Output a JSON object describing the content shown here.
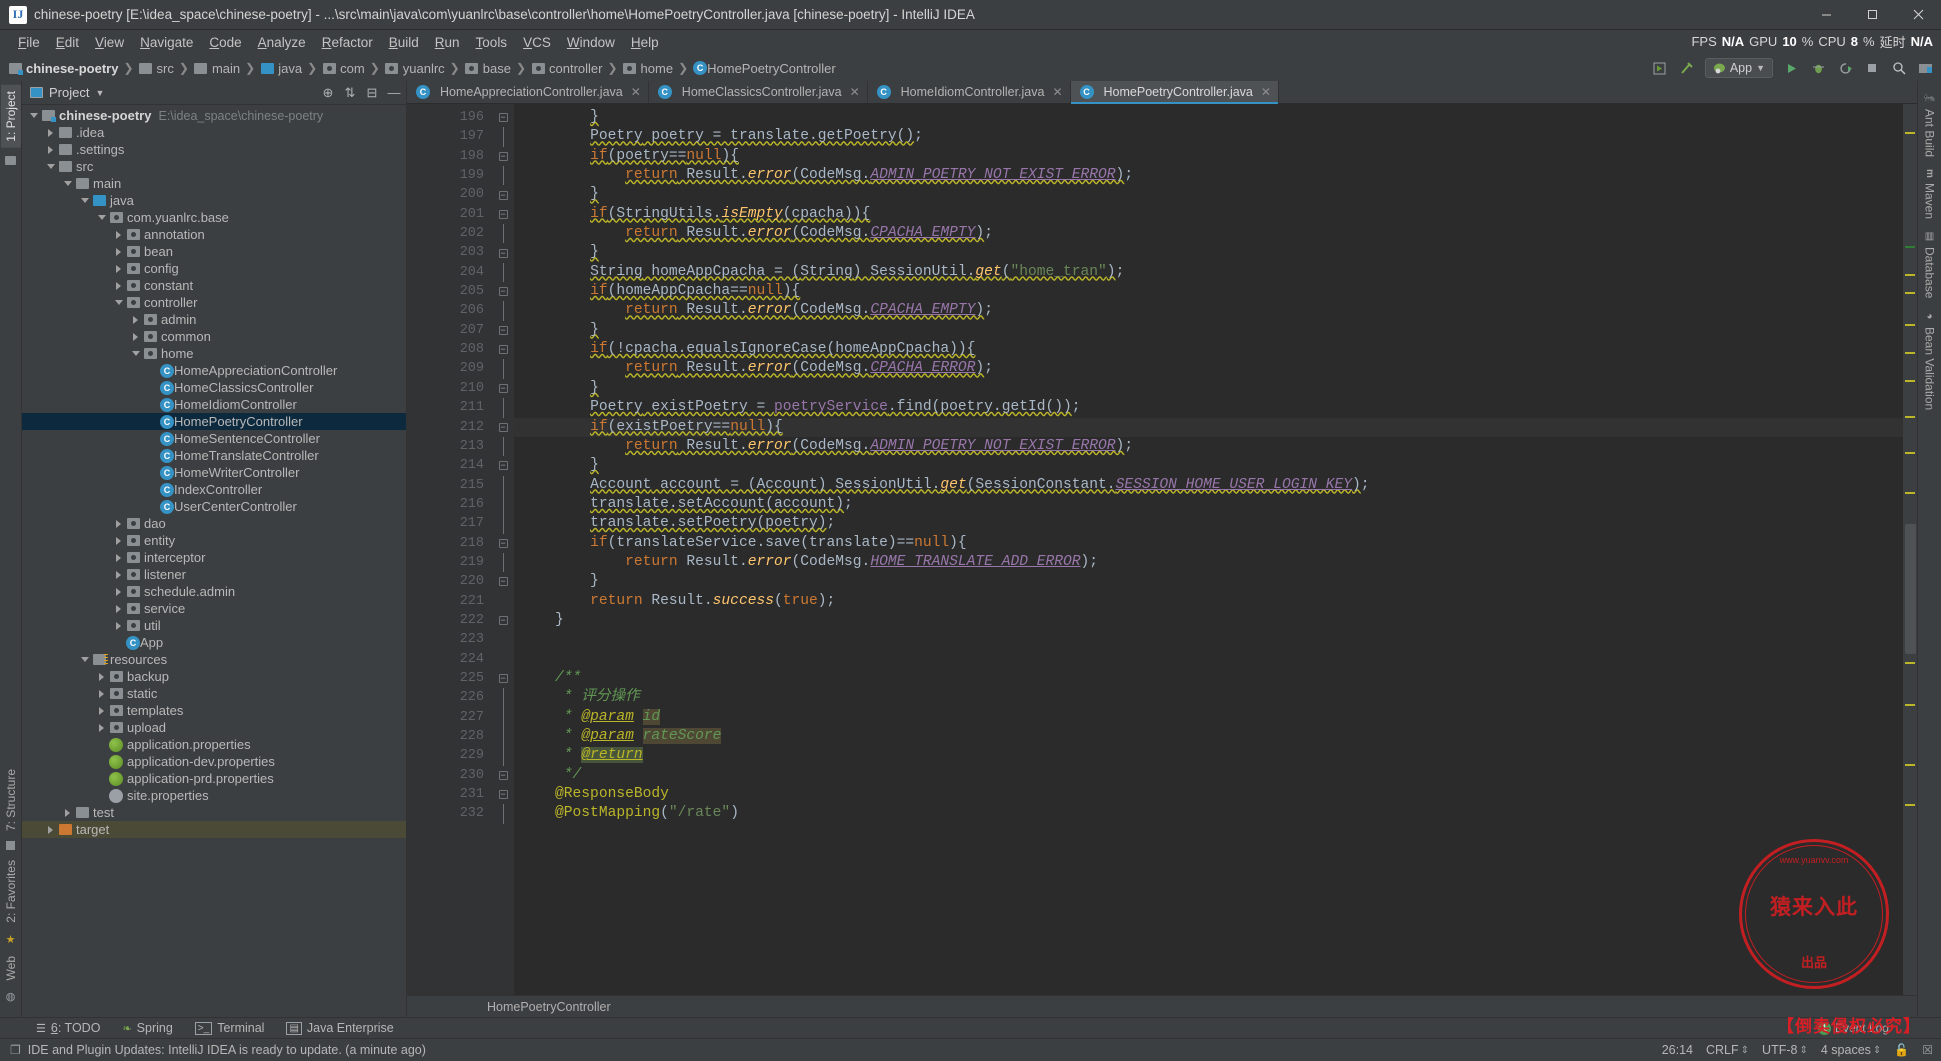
{
  "window": {
    "title": "chinese-poetry [E:\\idea_space\\chinese-poetry] - ...\\src\\main\\java\\com\\yuanlrc\\base\\controller\\home\\HomePoetryController.java [chinese-poetry] - IntelliJ IDEA",
    "app_icon": "IJ",
    "minimize_label": "Minimize",
    "maximize_label": "Maximize",
    "close_label": "Close"
  },
  "menu": {
    "items": [
      "File",
      "Edit",
      "View",
      "Navigate",
      "Code",
      "Analyze",
      "Refactor",
      "Build",
      "Run",
      "Tools",
      "VCS",
      "Window",
      "Help"
    ],
    "perf": {
      "fps_label": "FPS",
      "fps_value": "N/A",
      "gpu_label": "GPU",
      "gpu_value": "10",
      "gpu_unit": "%",
      "cpu_label": "CPU",
      "cpu_value": "8",
      "cpu_unit": "%",
      "latency_label": "延时",
      "latency_value": "N/A"
    }
  },
  "navbar": {
    "crumbs": [
      {
        "label": "chinese-poetry",
        "icon": "module-folder-icon",
        "bold": true
      },
      {
        "label": "src",
        "icon": "folder-icon",
        "bold": false
      },
      {
        "label": "main",
        "icon": "folder-icon",
        "bold": false
      },
      {
        "label": "java",
        "icon": "source-folder-icon",
        "bold": false
      },
      {
        "label": "com",
        "icon": "package-icon",
        "bold": false
      },
      {
        "label": "yuanlrc",
        "icon": "package-icon",
        "bold": false
      },
      {
        "label": "base",
        "icon": "package-icon",
        "bold": false
      },
      {
        "label": "controller",
        "icon": "package-icon",
        "bold": false
      },
      {
        "label": "home",
        "icon": "package-icon",
        "bold": false
      },
      {
        "label": "HomePoetryController",
        "icon": "class-icon",
        "bold": false
      }
    ],
    "run_config": "App",
    "right_icons": [
      "build-icon",
      "hammer-icon",
      "run-config-selector",
      "run-icon",
      "debug-icon",
      "coverage-icon",
      "stop-icon",
      "search-icon",
      "project-structure-icon"
    ]
  },
  "project_panel": {
    "header_label": "Project",
    "header_icons": [
      "locate-icon",
      "sort-icon",
      "collapse-all-icon",
      "hide-icon"
    ],
    "tree": [
      {
        "depth": 0,
        "label": "chinese-poetry",
        "path": "E:\\idea_space\\chinese-poetry",
        "icon": "module-folder-icon",
        "arrow": "open",
        "bold": true
      },
      {
        "depth": 1,
        "label": ".idea",
        "icon": "folder-icon",
        "arrow": "closed"
      },
      {
        "depth": 1,
        "label": ".settings",
        "icon": "folder-icon",
        "arrow": "closed"
      },
      {
        "depth": 1,
        "label": "src",
        "icon": "folder-icon",
        "arrow": "open"
      },
      {
        "depth": 2,
        "label": "main",
        "icon": "folder-icon",
        "arrow": "open"
      },
      {
        "depth": 3,
        "label": "java",
        "icon": "source-folder-icon",
        "arrow": "open"
      },
      {
        "depth": 4,
        "label": "com.yuanlrc.base",
        "icon": "package-icon",
        "arrow": "open"
      },
      {
        "depth": 5,
        "label": "annotation",
        "icon": "package-icon",
        "arrow": "closed"
      },
      {
        "depth": 5,
        "label": "bean",
        "icon": "package-icon",
        "arrow": "closed"
      },
      {
        "depth": 5,
        "label": "config",
        "icon": "package-icon",
        "arrow": "closed"
      },
      {
        "depth": 5,
        "label": "constant",
        "icon": "package-icon",
        "arrow": "closed"
      },
      {
        "depth": 5,
        "label": "controller",
        "icon": "package-icon",
        "arrow": "open"
      },
      {
        "depth": 6,
        "label": "admin",
        "icon": "package-icon",
        "arrow": "closed"
      },
      {
        "depth": 6,
        "label": "common",
        "icon": "package-icon",
        "arrow": "closed"
      },
      {
        "depth": 6,
        "label": "home",
        "icon": "package-icon",
        "arrow": "open"
      },
      {
        "depth": 7,
        "label": "HomeAppreciationController",
        "icon": "class-icon",
        "arrow": "none"
      },
      {
        "depth": 7,
        "label": "HomeClassicsController",
        "icon": "class-icon",
        "arrow": "none"
      },
      {
        "depth": 7,
        "label": "HomeIdiomController",
        "icon": "class-icon",
        "arrow": "none"
      },
      {
        "depth": 7,
        "label": "HomePoetryController",
        "icon": "class-icon",
        "arrow": "none",
        "selected": true
      },
      {
        "depth": 7,
        "label": "HomeSentenceController",
        "icon": "class-icon",
        "arrow": "none"
      },
      {
        "depth": 7,
        "label": "HomeTranslateController",
        "icon": "class-icon",
        "arrow": "none"
      },
      {
        "depth": 7,
        "label": "HomeWriterController",
        "icon": "class-icon",
        "arrow": "none"
      },
      {
        "depth": 7,
        "label": "IndexController",
        "icon": "class-icon",
        "arrow": "none"
      },
      {
        "depth": 7,
        "label": "UserCenterController",
        "icon": "class-icon",
        "arrow": "none"
      },
      {
        "depth": 5,
        "label": "dao",
        "icon": "package-icon",
        "arrow": "closed"
      },
      {
        "depth": 5,
        "label": "entity",
        "icon": "package-icon",
        "arrow": "closed"
      },
      {
        "depth": 5,
        "label": "interceptor",
        "icon": "package-icon",
        "arrow": "closed"
      },
      {
        "depth": 5,
        "label": "listener",
        "icon": "package-icon",
        "arrow": "closed"
      },
      {
        "depth": 5,
        "label": "schedule.admin",
        "icon": "package-icon",
        "arrow": "closed"
      },
      {
        "depth": 5,
        "label": "service",
        "icon": "package-icon",
        "arrow": "closed"
      },
      {
        "depth": 5,
        "label": "util",
        "icon": "package-icon",
        "arrow": "closed"
      },
      {
        "depth": 5,
        "label": "App",
        "icon": "spring-class-icon",
        "arrow": "none"
      },
      {
        "depth": 3,
        "label": "resources",
        "icon": "resource-folder-icon",
        "arrow": "open"
      },
      {
        "depth": 4,
        "label": "backup",
        "icon": "package-icon",
        "arrow": "closed"
      },
      {
        "depth": 4,
        "label": "static",
        "icon": "package-icon",
        "arrow": "closed"
      },
      {
        "depth": 4,
        "label": "templates",
        "icon": "package-icon",
        "arrow": "closed"
      },
      {
        "depth": 4,
        "label": "upload",
        "icon": "package-icon",
        "arrow": "closed"
      },
      {
        "depth": 4,
        "label": "application.properties",
        "icon": "spring-properties-icon",
        "arrow": "none"
      },
      {
        "depth": 4,
        "label": "application-dev.properties",
        "icon": "spring-properties-icon",
        "arrow": "none"
      },
      {
        "depth": 4,
        "label": "application-prd.properties",
        "icon": "spring-properties-icon",
        "arrow": "none"
      },
      {
        "depth": 4,
        "label": "site.properties",
        "icon": "properties-icon",
        "arrow": "none"
      },
      {
        "depth": 2,
        "label": "test",
        "icon": "folder-icon",
        "arrow": "closed"
      },
      {
        "depth": 1,
        "label": "target",
        "icon": "target-folder-icon",
        "arrow": "closed",
        "highlighted": true
      }
    ]
  },
  "left_strip": {
    "top": [
      "1: Project"
    ],
    "bottom": [
      "7: Structure",
      "2: Favorites",
      "Web"
    ]
  },
  "right_strip": [
    {
      "label": "Ant Build",
      "icon": "ant-icon"
    },
    {
      "label": "Maven",
      "icon": "maven-icon"
    },
    {
      "label": "Database",
      "icon": "database-icon"
    },
    {
      "label": "Bean Validation",
      "icon": "bean-validation-icon"
    }
  ],
  "editor": {
    "tabs": [
      {
        "label": "HomeAppreciationController.java",
        "active": false
      },
      {
        "label": "HomeClassicsController.java",
        "active": false
      },
      {
        "label": "HomeIdiomController.java",
        "active": false
      },
      {
        "label": "HomePoetryController.java",
        "active": true
      }
    ],
    "first_line": 196,
    "current_line": 212,
    "breadcrumb": "HomePoetryController",
    "lines": [
      {
        "n": 196,
        "fold": "end",
        "html": "        <span class=\"warn\">}</span>"
      },
      {
        "n": 197,
        "fold": "bar",
        "html": "        <span class=\"warn\"><span class=\"type\">Poetry</span> poetry = translate.getPoetry()</span>;"
      },
      {
        "n": 198,
        "fold": "start",
        "html": "        <span class=\"warn\"><span class=\"kw\">if</span>(poetry==<span class=\"kw\">null</span>){</span>"
      },
      {
        "n": 199,
        "fold": "bar",
        "html": "            <span class=\"warn\"><span class=\"kw\">return</span> Result.<span class=\"mth\">error</span>(CodeMsg.<span class=\"sfld\">ADMIN_POETRY_NOT_EXIST_ERROR</span>)</span>;"
      },
      {
        "n": 200,
        "fold": "end",
        "html": "        <span class=\"warn\">}</span>"
      },
      {
        "n": 201,
        "fold": "start",
        "html": "        <span class=\"warn\"><span class=\"kw\">if</span>(StringUtils.<span class=\"mth\">isEmpty</span>(cpacha)){</span>"
      },
      {
        "n": 202,
        "fold": "bar",
        "html": "            <span class=\"warn\"><span class=\"kw\">return</span> Result.<span class=\"mth\">error</span>(CodeMsg.<span class=\"sfld\">CPACHA_EMPTY</span>)</span>;"
      },
      {
        "n": 203,
        "fold": "end",
        "html": "        <span class=\"warn\">}</span>"
      },
      {
        "n": 204,
        "fold": "bar",
        "html": "        <span class=\"warn\"><span class=\"type\">String</span> homeAppCpacha = (<span class=\"type\">String</span>) SessionUtil.<span class=\"mth\">get</span>(<span class=\"str\">\"home_tran\"</span>)</span>;"
      },
      {
        "n": 205,
        "fold": "start",
        "html": "        <span class=\"warn\"><span class=\"kw\">if</span>(homeAppCpacha==<span class=\"kw\">null</span>){</span>"
      },
      {
        "n": 206,
        "fold": "bar",
        "html": "            <span class=\"warn\"><span class=\"kw\">return</span> Result.<span class=\"mth\">error</span>(CodeMsg.<span class=\"sfld\">CPACHA_EMPTY</span>)</span>;"
      },
      {
        "n": 207,
        "fold": "end",
        "html": "        <span class=\"warn\">}</span>"
      },
      {
        "n": 208,
        "fold": "start",
        "html": "        <span class=\"warn\"><span class=\"kw\">if</span>(!cpacha.equalsIgnoreCase(homeAppCpacha)){</span>"
      },
      {
        "n": 209,
        "fold": "bar",
        "html": "            <span class=\"warn\"><span class=\"kw\">return</span> Result.<span class=\"mth\">error</span>(CodeMsg.<span class=\"sfld\">CPACHA_ERROR</span>)</span>;"
      },
      {
        "n": 210,
        "fold": "end",
        "html": "        <span class=\"warn\">}</span>"
      },
      {
        "n": 211,
        "fold": "bar",
        "html": "        <span class=\"warn\"><span class=\"type\">Poetry</span> existPoetry = <span class=\"svc\">poetryService</span>.find(poetry.getId())</span>;"
      },
      {
        "n": 212,
        "fold": "start",
        "current": true,
        "html": "        <span class=\"warn\"><span class=\"kw\">if</span>(existPoetry==<span class=\"kw\">null</span>){</span>"
      },
      {
        "n": 213,
        "fold": "bar",
        "html": "            <span class=\"warn\"><span class=\"kw\">return</span> Result.<span class=\"mth\">error</span>(CodeMsg.<span class=\"sfld\">ADMIN_POETRY_NOT_EXIST_ERROR</span>)</span>;"
      },
      {
        "n": 214,
        "fold": "end",
        "html": "        <span class=\"warn\">}</span>"
      },
      {
        "n": 215,
        "fold": "bar",
        "html": "        <span class=\"warn\"><span class=\"type\">Account</span> account = (<span class=\"type\">Account</span>) SessionUtil.<span class=\"mth\">get</span>(SessionConstant.<span class=\"sfld\">SESSION_HOME_USER_LOGIN_KEY</span>)</span>;"
      },
      {
        "n": 216,
        "fold": "bar",
        "html": "        <span class=\"warn\">translate.setAccount(account)</span>;"
      },
      {
        "n": 217,
        "fold": "bar",
        "html": "        <span class=\"warn\">translate.setPoetry(poetry)</span>;"
      },
      {
        "n": 218,
        "fold": "start",
        "html": "        <span class=\"kw\">if</span>(translateService.save(translate)==<span class=\"kw\">null</span>){"
      },
      {
        "n": 219,
        "fold": "bar",
        "html": "            <span class=\"kw\">return</span> Result.<span class=\"mth\">error</span>(CodeMsg.<span class=\"sfld\">HOME_TRANSLATE_ADD_ERROR</span>);"
      },
      {
        "n": 220,
        "fold": "end",
        "html": "        }"
      },
      {
        "n": 221,
        "fold": "none",
        "html": "        <span class=\"kw\">return</span> Result.<span class=\"mth\">success</span>(<span class=\"kw\">true</span>);"
      },
      {
        "n": 222,
        "fold": "end",
        "html": "    }"
      },
      {
        "n": 223,
        "fold": "none",
        "html": ""
      },
      {
        "n": 224,
        "fold": "none",
        "html": ""
      },
      {
        "n": 225,
        "fold": "start",
        "html": "    <span class=\"cmt\">/**</span>"
      },
      {
        "n": 226,
        "fold": "bar",
        "html": "     <span class=\"cmt\">* 评分操作</span>"
      },
      {
        "n": 227,
        "fold": "bar",
        "html": "     <span class=\"cmt\">* <span class=\"tag\" style=\"text-decoration:underline\">@param</span> <span class=\"hl-p\">id</span></span>"
      },
      {
        "n": 228,
        "fold": "bar",
        "html": "     <span class=\"cmt\">* <span class=\"tag\" style=\"text-decoration:underline\">@param</span> <span class=\"hl-p\">rateScore</span></span>"
      },
      {
        "n": 229,
        "fold": "bar",
        "html": "     <span class=\"cmt\">* <span class=\"tag hl-g\" style=\"text-decoration:underline\">@return</span></span>"
      },
      {
        "n": 230,
        "fold": "end",
        "html": "     <span class=\"cmt\">*/</span>"
      },
      {
        "n": 231,
        "fold": "start",
        "html": "    <span class=\"anno\">@ResponseBody</span>"
      },
      {
        "n": 232,
        "fold": "bar",
        "html": "    <span class=\"anno\">@PostMapping</span>(<span class=\"str\">\"/rate\"</span>)"
      }
    ]
  },
  "tool_windows": [
    {
      "num": "6",
      "label": ": TODO",
      "icon": "todo-icon"
    },
    {
      "label": "Spring",
      "icon": "spring-icon"
    },
    {
      "label": "Terminal",
      "icon": "terminal-icon"
    },
    {
      "label": "Java Enterprise",
      "icon": "java-enterprise-icon"
    }
  ],
  "statusbar": {
    "message": "IDE and Plugin Updates: IntelliJ IDEA is ready to update. (a minute ago)",
    "message_icon": "notification-icon",
    "caret_position": "26:14",
    "line_separator": "CRLF",
    "encoding": "UTF-8",
    "indent": "4 spaces",
    "lock_icon": "unlock-icon",
    "inspection_icon": "inspections-icon",
    "event_log": "Event Log",
    "event_log_count": "1"
  },
  "watermark": {
    "top_text": "www.yuanvv.com",
    "center_text": "猿来入此",
    "bottom_text": "出品",
    "footer_text": "【倒卖侵权必究】"
  },
  "colors": {
    "accent": "#3592c4",
    "background": "#3c3f41",
    "editor_bg": "#2b2b2b",
    "selection": "#0d293e",
    "keyword": "#cc7832",
    "string": "#6a8759",
    "comment": "#629755",
    "field": "#9876aa",
    "method": "#ffc66d",
    "warning": "#bbb529"
  }
}
